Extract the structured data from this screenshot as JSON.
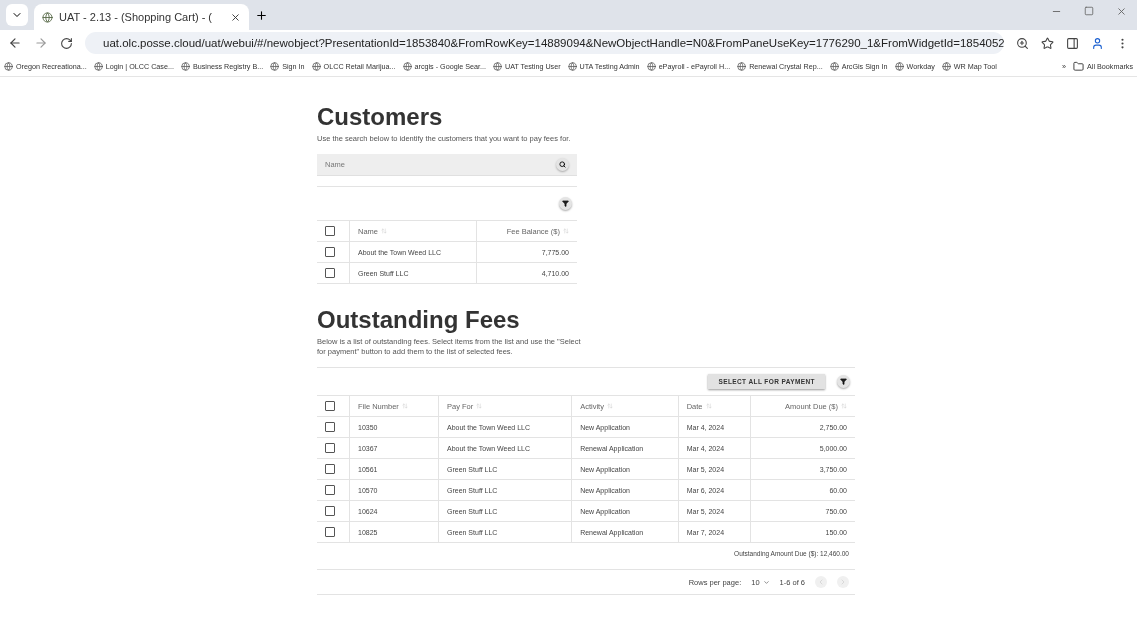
{
  "browser": {
    "tab_title": "UAT - 2.13 - (Shopping Cart) - (",
    "url": "uat.olc.posse.cloud/uat/webui/#/newobject?PresentationId=1853840&FromRowKey=14889094&NewObjectHandle=N0&FromPaneUseKey=1776290_1&FromWidgetId=1854052",
    "bookmarks": [
      "Oregon Recreationa...",
      "Login | OLCC Case...",
      "Business Registry B...",
      "Sign In",
      "OLCC Retail Marijua...",
      "arcgis - Google Sear...",
      "UAT Testing User",
      "UTA Testing Admin",
      "ePayroll - ePayroll H...",
      "Renewal Crystal Rep...",
      "ArcGis Sign In",
      "Workday",
      "WR Map Tool"
    ],
    "more": "»",
    "all_bookmarks": "All Bookmarks"
  },
  "customers": {
    "title": "Customers",
    "description": "Use the search below to identify the customers that you want to pay fees for.",
    "search": {
      "placeholder": "Name"
    },
    "columns": [
      "Name",
      "Fee Balance ($)"
    ],
    "header_checked": false,
    "rows": [
      {
        "checked": false,
        "cells": [
          "About the Town Weed LLC",
          "7,775.00"
        ]
      },
      {
        "checked": false,
        "cells": [
          "Green Stuff LLC",
          "4,710.00"
        ]
      }
    ]
  },
  "fees": {
    "title": "Outstanding Fees",
    "description": "Below is a list of outstanding fees. Select items from the list and use the \"Select for payment\" button to add them to the list of selected fees.",
    "select_all_button": "SELECT ALL FOR PAYMENT",
    "columns": [
      "File Number",
      "Pay For",
      "Activity",
      "Date",
      "Amount Due ($)"
    ],
    "header_checked": false,
    "rows": [
      {
        "checked": false,
        "cells": [
          "10350",
          "About the Town Weed LLC",
          "New Application",
          "Mar 4, 2024",
          "2,750.00"
        ]
      },
      {
        "checked": false,
        "cells": [
          "10367",
          "About the Town Weed LLC",
          "Renewal Application",
          "Mar 4, 2024",
          "5,000.00"
        ]
      },
      {
        "checked": false,
        "cells": [
          "10561",
          "Green Stuff LLC",
          "New Application",
          "Mar 5, 2024",
          "3,750.00"
        ]
      },
      {
        "checked": false,
        "cells": [
          "10570",
          "Green Stuff LLC",
          "New Application",
          "Mar 6, 2024",
          "60.00"
        ]
      },
      {
        "checked": false,
        "cells": [
          "10624",
          "Green Stuff LLC",
          "New Application",
          "Mar 5, 2024",
          "750.00"
        ]
      },
      {
        "checked": false,
        "cells": [
          "10825",
          "Green Stuff LLC",
          "Renewal Application",
          "Mar 7, 2024",
          "150.00"
        ]
      }
    ],
    "total": "Outstanding Amount Due ($): 12,460.00",
    "pagination": {
      "rows_per_page_label": "Rows per page:",
      "rows_per_page": "10",
      "range": "1-6 of 6"
    }
  }
}
